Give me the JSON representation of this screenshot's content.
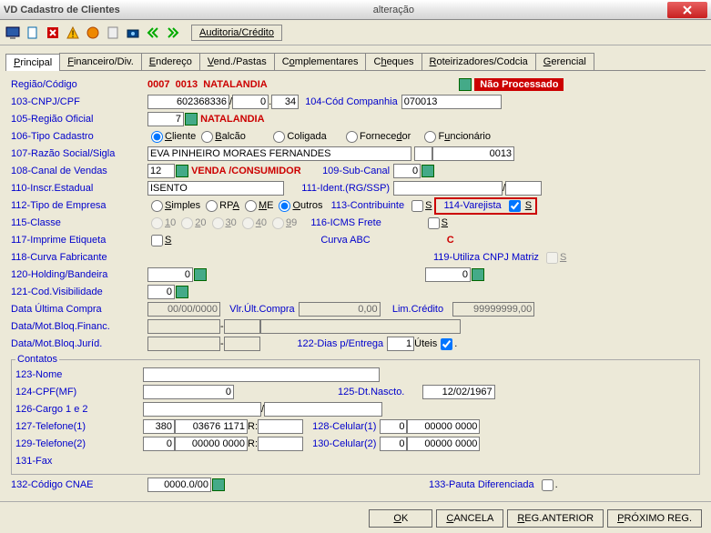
{
  "window": {
    "app": "VD",
    "title": "Cadastro de Clientes",
    "mode": "alteração"
  },
  "auditBtn": "Auditoria/Crédito",
  "tabs": [
    "Principal",
    "Financeiro/Div.",
    "Endereço",
    "Vend./Pastas",
    "Complementares",
    "Cheques",
    "Roteirizadores/Codcia",
    "Gerencial"
  ],
  "status_badge": "Não Processado",
  "regiao": {
    "label": "Região/Código",
    "cod1": "0007",
    "cod2": "0013",
    "nome": "NATALANDIA"
  },
  "f103": {
    "label": "103-CNPJ/CPF",
    "v1": "602368336",
    "v2": "0",
    "v3": "34"
  },
  "f104": {
    "label": "104-Cód Companhia",
    "val": "070013"
  },
  "f105": {
    "label": "105-Região Oficial",
    "val": "7",
    "nome": "NATALANDIA"
  },
  "f106": {
    "label": "106-Tipo Cadastro",
    "opts": [
      "Cliente",
      "Balcão",
      "Coligada",
      "Fornecedor",
      "Funcionário"
    ]
  },
  "f107": {
    "label": "107-Razão Social/Sigla",
    "val": "EVA PINHEIRO MORAES FERNANDES",
    "sigla": "0013"
  },
  "f108": {
    "label": "108-Canal de Vendas",
    "val": "12",
    "desc": "VENDA /CONSUMIDOR"
  },
  "f109": {
    "label": "109-Sub-Canal",
    "val": "0"
  },
  "f110": {
    "label": "110-Inscr.Estadual",
    "val": "ISENTO"
  },
  "f111": {
    "label": "111-Ident.(RG/SSP)"
  },
  "f112": {
    "label": "112-Tipo de Empresa",
    "opts": [
      "Simples",
      "RPA",
      "ME",
      "Outros"
    ]
  },
  "f113": {
    "label": "113-Contribuinte",
    "s": "S"
  },
  "f114": {
    "label": "114-Varejista",
    "s": "S"
  },
  "f115": {
    "label": "115-Classe",
    "opts": [
      "10",
      "20",
      "30",
      "40",
      "99"
    ]
  },
  "f116": {
    "label": "116-ICMS Frete",
    "s": "S"
  },
  "curvaABC": {
    "label": "Curva ABC",
    "val": "C"
  },
  "f117": {
    "label": "117-Imprime Etiqueta",
    "s": "S"
  },
  "f118": {
    "label": "118-Curva Fabricante"
  },
  "f119": {
    "label": "119-Utiliza CNPJ Matriz",
    "s": "S"
  },
  "f120": {
    "label": "120-Holding/Bandeira",
    "v1": "0",
    "v2": "0"
  },
  "f121": {
    "label": "121-Cod.Visibilidade",
    "val": "0"
  },
  "dataUltCompra": {
    "label": "Data Última Compra",
    "val": "00/00/0000"
  },
  "vlrUltCompra": {
    "label": "Vlr.Últ.Compra",
    "val": "0,00"
  },
  "limCredito": {
    "label": "Lim.Crédito",
    "val": "99999999,00"
  },
  "motFinanc": {
    "label": "Data/Mot.Bloq.Financ."
  },
  "motJurid": {
    "label": "Data/Mot.Bloq.Juríd."
  },
  "f122": {
    "label": "122-Dias p/Entrega",
    "val": "1",
    "uteis": "Úteis"
  },
  "contatos": "Contatos",
  "f123": {
    "label": "123-Nome"
  },
  "f124": {
    "label": "124-CPF(MF)",
    "val": "0"
  },
  "f125": {
    "label": "125-Dt.Nascto.",
    "val": "12/02/1967"
  },
  "f126": {
    "label": "126-Cargo 1 e 2"
  },
  "f127": {
    "label": "127-Telefone(1)",
    "ddd": "380",
    "num": "03676 1171",
    "r": "R:"
  },
  "f128": {
    "label": "128-Celular(1)",
    "ddd": "0",
    "num": "00000 0000"
  },
  "f129": {
    "label": "129-Telefone(2)",
    "ddd": "0",
    "num": "00000 0000",
    "r": "R:"
  },
  "f130": {
    "label": "130-Celular(2)",
    "ddd": "0",
    "num": "00000 0000"
  },
  "f131": {
    "label": "131-Fax"
  },
  "f132": {
    "label": "132-Código CNAE",
    "val": "0000.0/00"
  },
  "f133": {
    "label": "133-Pauta Diferenciada"
  },
  "buttons": {
    "ok": "OK",
    "cancel": "CANCELA",
    "prev": "REG.ANTERIOR",
    "next": "PRÓXIMO REG."
  }
}
